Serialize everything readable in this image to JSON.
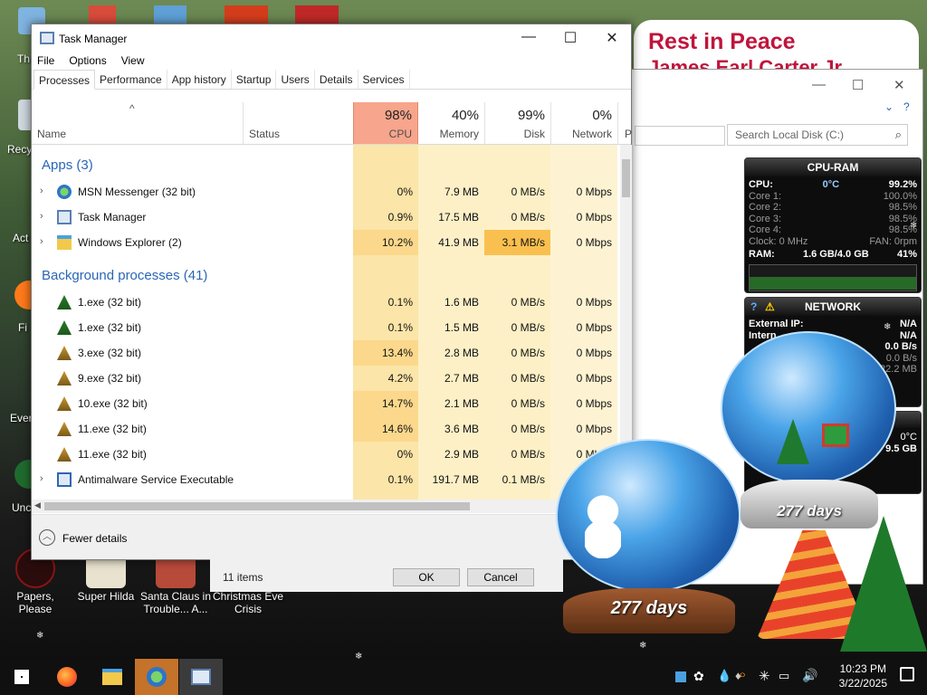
{
  "desktop": {
    "icons": [
      {
        "label": "Papers, Please"
      },
      {
        "label": "Super Hilda"
      },
      {
        "label": "Santa Claus in Trouble... A..."
      },
      {
        "label": "Christmas Eve Crisis"
      }
    ],
    "edge_labels": [
      "Th",
      "Recy",
      "Act",
      "Fi",
      "Ever",
      "Unc"
    ]
  },
  "banner": {
    "line1": "Rest in Peace",
    "line2": "James Earl Carter Jr"
  },
  "explorer": {
    "search_placeholder": "Search Local Disk (C:)"
  },
  "task_manager": {
    "title": "Task Manager",
    "menu": [
      "File",
      "Options",
      "View"
    ],
    "tabs": [
      "Processes",
      "Performance",
      "App history",
      "Startup",
      "Users",
      "Details",
      "Services"
    ],
    "columns": {
      "name": "Name",
      "status": "Status",
      "cpu": {
        "pct": "98%",
        "label": "CPU"
      },
      "memory": {
        "pct": "40%",
        "label": "Memory"
      },
      "disk": {
        "pct": "99%",
        "label": "Disk"
      },
      "network": {
        "pct": "0%",
        "label": "Network"
      },
      "power_cut": "P"
    },
    "groups": {
      "apps": "Apps (3)",
      "background": "Background processes (41)"
    },
    "apps": [
      {
        "name": "MSN Messenger (32 bit)",
        "cpu": "0%",
        "mem": "7.9 MB",
        "disk": "0 MB/s",
        "net": "0 Mbps",
        "icon": "msn-icon"
      },
      {
        "name": "Task Manager",
        "cpu": "0.9%",
        "mem": "17.5 MB",
        "disk": "0 MB/s",
        "net": "0 Mbps",
        "icon": "taskmgr-icon"
      },
      {
        "name": "Windows Explorer (2)",
        "cpu": "10.2%",
        "mem": "41.9 MB",
        "disk": "3.1 MB/s",
        "net": "0 Mbps",
        "icon": "folder-icon"
      }
    ],
    "background": [
      {
        "name": "1.exe (32 bit)",
        "cpu": "0.1%",
        "mem": "1.6 MB",
        "disk": "0 MB/s",
        "net": "0 Mbps"
      },
      {
        "name": "1.exe (32 bit)",
        "cpu": "0.1%",
        "mem": "1.5 MB",
        "disk": "0 MB/s",
        "net": "0 Mbps"
      },
      {
        "name": "3.exe (32 bit)",
        "cpu": "13.4%",
        "mem": "2.8 MB",
        "disk": "0 MB/s",
        "net": "0 Mbps"
      },
      {
        "name": "9.exe (32 bit)",
        "cpu": "4.2%",
        "mem": "2.7 MB",
        "disk": "0 MB/s",
        "net": "0 Mbps"
      },
      {
        "name": "10.exe (32 bit)",
        "cpu": "14.7%",
        "mem": "2.1 MB",
        "disk": "0 MB/s",
        "net": "0 Mbps"
      },
      {
        "name": "11.exe (32 bit)",
        "cpu": "14.6%",
        "mem": "3.6 MB",
        "disk": "0 MB/s",
        "net": "0 Mbps"
      },
      {
        "name": "11.exe (32 bit)",
        "cpu": "0%",
        "mem": "2.9 MB",
        "disk": "0 MB/s",
        "net": "0 Mbps"
      },
      {
        "name": "Antimalware Service Executable",
        "cpu": "0.1%",
        "mem": "191.7 MB",
        "disk": "0.1 MB/s",
        "net": "0 Mbps"
      }
    ],
    "fewer_details": "Fewer details"
  },
  "dialog": {
    "items": "11 items",
    "ok": "OK",
    "cancel": "Cancel"
  },
  "cpu_gadget": {
    "title": "CPU-RAM",
    "cpu_label": "CPU:",
    "cpu_temp": "0°C",
    "cpu_value": "99.2%",
    "cores": [
      {
        "label": "Core 1:",
        "value": "100.0%"
      },
      {
        "label": "Core 2:",
        "value": "98.5%"
      },
      {
        "label": "Core 3:",
        "value": "98.5%"
      },
      {
        "label": "Core 4:",
        "value": "98.5%"
      }
    ],
    "clock": "Clock: 0 MHz",
    "fan": "FAN: 0rpm",
    "ram_label": "RAM:",
    "ram_value": "1.6 GB/4.0 GB",
    "ram_pct": "41%"
  },
  "network_gadget": {
    "title": "NETWORK",
    "external_ip_label": "External IP:",
    "external_ip": "N/A",
    "internal_label": "Intern",
    "internal": "N/A",
    "rate1": "0.0 B/s",
    "rate2": "0.0 B/s",
    "rate3": "22.2 MB"
  },
  "third_gadget": {
    "temp": "0°C",
    "value": "9.5 GB"
  },
  "globes": {
    "left_days": "277 days",
    "right_days": "277 days"
  },
  "taskbar": {
    "time": "10:23 PM",
    "date": "3/22/2025"
  },
  "colors": {
    "cpu_header": "#f7a58c",
    "group_blue": "#2a66b6",
    "banner_red": "#c0143c"
  }
}
